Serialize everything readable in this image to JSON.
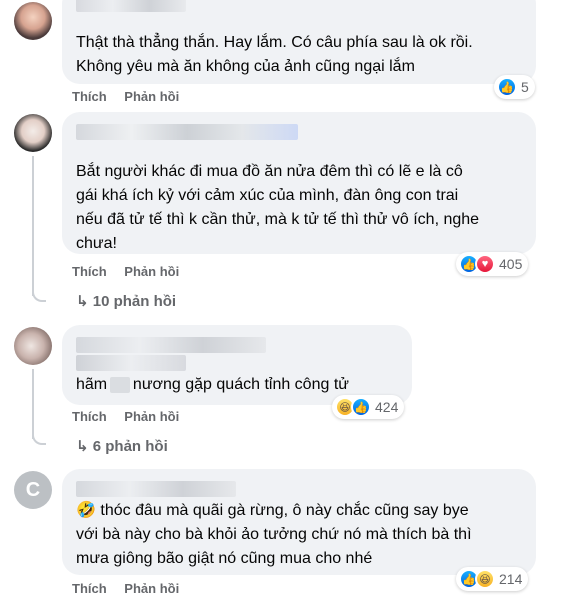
{
  "comments": [
    {
      "lines": [
        "Thật thà thẳng thắn. Hay lắm. Có câu phía sau là ok rồi.",
        "Không yêu mà ăn không của ảnh cũng ngại lắm"
      ],
      "like_label": "Thích",
      "reply_label": "Phản hồi",
      "reaction_count": "5"
    },
    {
      "lines": [
        "Bắt người khác đi mua đồ ăn nửa đêm thì có lẽ e là cô",
        "gái khá ích kỷ với cảm xúc của mình, đàn ông con trai",
        "nếu đã tử tế thì k cần thử, mà k tử tế thì thử vô ích, nghe",
        "chưa!"
      ],
      "like_label": "Thích",
      "reply_label": "Phản hồi",
      "reaction_count": "405",
      "replies_label": "10 phản hồi"
    },
    {
      "lines": [
        "hãm      cô nương gặp quách tỉnh công tử"
      ],
      "like_label": "Thích",
      "reply_label": "Phản hồi",
      "reaction_count": "424",
      "replies_label": "6 phản hồi"
    },
    {
      "avatar_letter": "C",
      "lines": [
        "thóc đâu mà quãi gà rừng, ô này chắc cũng say bye",
        "với bà này cho bà khỏi ảo tưởng chứ nó mà thích bà thì",
        "mưa giông bão giật nó cũng mua cho nhé"
      ],
      "like_label": "Thích",
      "reply_label": "Phản hồi",
      "reaction_count": "214"
    }
  ],
  "icons": {
    "like": "thumbs-up-icon",
    "love": "heart-icon",
    "haha": "laughing-face-icon",
    "reply_arrow": "reply-arrow-icon"
  },
  "colors": {
    "bubble": "#f0f2f5",
    "meta_text": "#65676b",
    "like_blue": "#0062df",
    "love_red": "#e61739"
  }
}
